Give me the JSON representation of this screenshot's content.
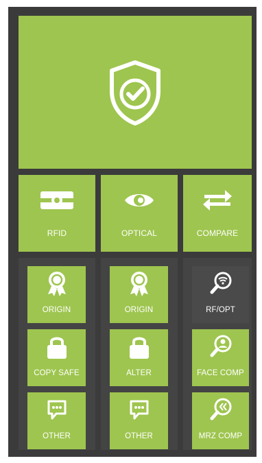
{
  "colors": {
    "tile": "#9ec54f",
    "tile_selected": "#4a4a4a",
    "frame": "#3b3b3b"
  },
  "hero": {
    "icon": "shield-check-icon"
  },
  "checks": [
    {
      "label": "RFID",
      "icon": "rfid-card-icon"
    },
    {
      "label": "OPTICAL",
      "icon": "eye-icon"
    },
    {
      "label": "COMPARE",
      "icon": "swap-arrows-icon"
    }
  ],
  "rfid_column": [
    {
      "label": "ORIGIN",
      "icon": "award-ribbon-icon"
    },
    {
      "label": "COPY SAFE",
      "icon": "lock-icon"
    },
    {
      "label": "OTHER",
      "icon": "chat-dots-icon"
    }
  ],
  "optical_column": [
    {
      "label": "ORIGIN",
      "icon": "award-ribbon-icon"
    },
    {
      "label": "ALTER",
      "icon": "lock-icon"
    },
    {
      "label": "OTHER",
      "icon": "chat-dots-icon"
    }
  ],
  "compare_column": [
    {
      "label": "RF/OPT",
      "icon": "search-wifi-icon"
    },
    {
      "label": "FACE COMP",
      "icon": "search-face-icon"
    },
    {
      "label": "MRZ COMP",
      "icon": "search-chevrons-icon"
    }
  ]
}
